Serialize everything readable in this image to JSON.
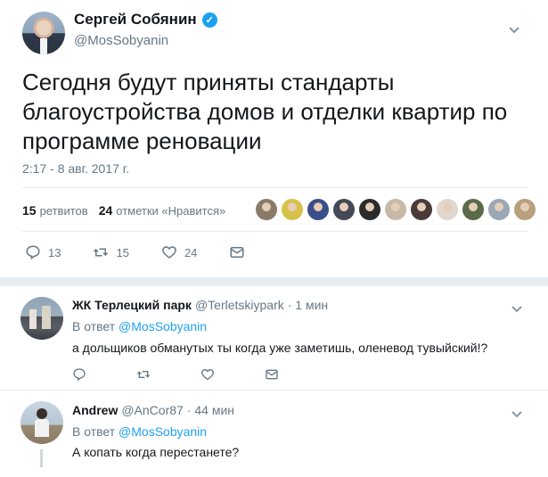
{
  "tweet": {
    "author_name": "Сергей Собянин",
    "author_handle": "@MosSobyanin",
    "text": "Сегодня будут приняты стандарты благоустройства домов и отделки квартир по программе реновации",
    "timestamp": "2:17 - 8 авг. 2017 г.",
    "retweets_count": "15",
    "retweets_label": "ретвитов",
    "likes_count": "24",
    "likes_label": "отметки «Нравится»",
    "actions": {
      "replies": "13",
      "retweets": "15",
      "likes": "24"
    },
    "liker_colors": [
      "#8a7a6a",
      "#d6c24a",
      "#3a4f8a",
      "#444a55",
      "#2b2b2b",
      "#c7b9a8",
      "#4a3a3a",
      "#e0d8cf",
      "#5a6a4a",
      "#9aa7b5",
      "#b9a07d"
    ]
  },
  "replies": [
    {
      "author_name": "ЖК Терлецкий парк",
      "author_handle": "@Terletskiypark",
      "time": "· 1 мин",
      "in_reply_prefix": "В ответ",
      "in_reply_handle": "@MosSobyanin",
      "text": "а дольщиков обманутых ты когда уже заметишь, оленевод тувыйский!?"
    },
    {
      "author_name": "Andrew",
      "author_handle": "@AnCor87",
      "time": "· 44 мин",
      "in_reply_prefix": "В ответ",
      "in_reply_handle": "@MosSobyanin",
      "text": "А копать когда перестанете?"
    }
  ],
  "colors": {
    "accent": "#1da1f2",
    "muted": "#657786",
    "divider": "#e6ecf0"
  }
}
